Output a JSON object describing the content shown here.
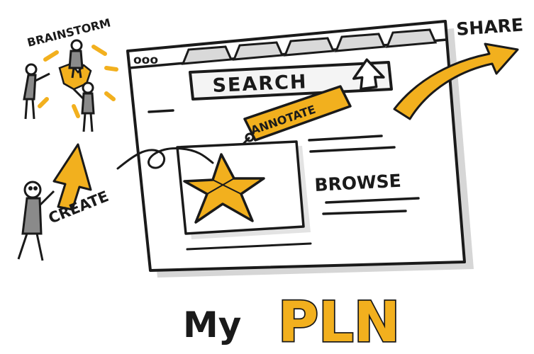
{
  "labels": {
    "brainstorm": "BRAINSTORM",
    "create": "CREATE",
    "search": "SEARCH",
    "annotate": "ANNOTATE",
    "browse": "BROWSE",
    "share": "SHARE",
    "title_prefix": "My",
    "title_main": "PLN"
  },
  "window_controls": "ooo",
  "colors": {
    "accent": "#f2b01e",
    "ink": "#1a1a1a",
    "shadow": "#d6d6d6"
  },
  "icons": [
    "cursor-arrow-icon",
    "star-icon",
    "arrow-up-right-icon",
    "arrow-up-icon"
  ]
}
